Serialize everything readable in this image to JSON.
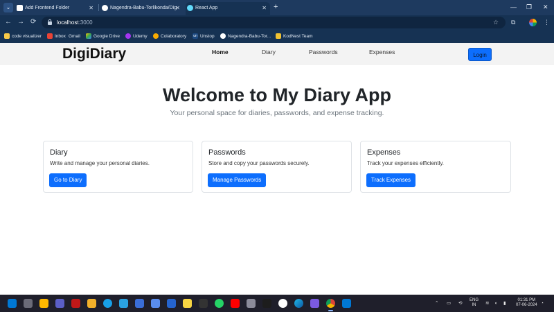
{
  "browser": {
    "tabs": [
      {
        "title": "Add Frontend Folder",
        "active": false
      },
      {
        "title": "Nagendra-Babu-Torlikonda/Dig",
        "active": false
      },
      {
        "title": "React App",
        "active": true
      }
    ],
    "url_host": "localhost",
    "url_rest": ":3000",
    "bookmarks": [
      "code visualizer",
      "Inbox",
      "Gmail",
      "Google Drive",
      "Udemy",
      "Colaboratory",
      "Unstop",
      "Nagendra-Babu-Tor...",
      "KodNest Team"
    ]
  },
  "navbar": {
    "brand": "DigiDiary",
    "links": [
      "Home",
      "Diary",
      "Passwords",
      "Expenses"
    ],
    "active_link": "Home",
    "login_label": "Login"
  },
  "hero": {
    "title": "Welcome to My Diary App",
    "subtitle": "Your personal space for diaries, passwords, and expense tracking."
  },
  "cards": [
    {
      "title": "Diary",
      "text": "Write and manage your personal diaries.",
      "button": "Go to Diary"
    },
    {
      "title": "Passwords",
      "text": "Store and copy your passwords securely.",
      "button": "Manage Passwords"
    },
    {
      "title": "Expenses",
      "text": "Track your expenses efficiently.",
      "button": "Track Expenses"
    }
  ],
  "taskbar": {
    "language": "ENG",
    "region": "IN",
    "time": "01:31 PM",
    "date": "07-06-2024",
    "pinned_icons": [
      "windows-start",
      "task-view",
      "notification-app",
      "teams",
      "mcafee",
      "file-explorer",
      "edge-dev",
      "notepad",
      "store",
      "copilot",
      "todo",
      "sticky-notes",
      "terminal",
      "whatsapp",
      "youtube",
      "app-gray",
      "news-app",
      "uber",
      "edge",
      "media-player",
      "chrome",
      "vscode"
    ]
  },
  "colors": {
    "primary": "#0d6efd",
    "navbar_bg": "#f3f3f3",
    "browser_frame": "#163253",
    "taskbar_bg": "#1f1f2b"
  }
}
